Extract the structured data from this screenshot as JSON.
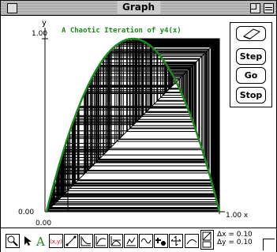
{
  "window": {
    "title": "Graph"
  },
  "plot": {
    "title": "A Chaotic Iteration of y4(x)",
    "y_axis_label": "y",
    "x_axis_end_label": "1.00 x",
    "y_max_label": "1.00",
    "y_min_label": "0.00",
    "x_min_label": "0.00",
    "curve_color": "#1a8a1a",
    "web_color": "#000000"
  },
  "controls": {
    "eraser_icon": "eraser-icon",
    "step_label": "Step",
    "go_label": "Go",
    "stop_label": "Stop"
  },
  "toolbar": {
    "tools": [
      "magnifier-icon",
      "arrow-pointer-icon",
      "text-tool-icon",
      "coordinate-label-icon",
      "line-tool-icon",
      "function-graph-icon",
      "derivative-graph-icon",
      "tangent-line-icon",
      "secant-line-icon",
      "wave-graph-icon",
      "move-plus-icon",
      "zoom-axes-icon",
      "curve-icon",
      "scale-grid-icon"
    ],
    "delta_x": "Δx = 0.10",
    "delta_y": "Δy = 0.10"
  }
}
